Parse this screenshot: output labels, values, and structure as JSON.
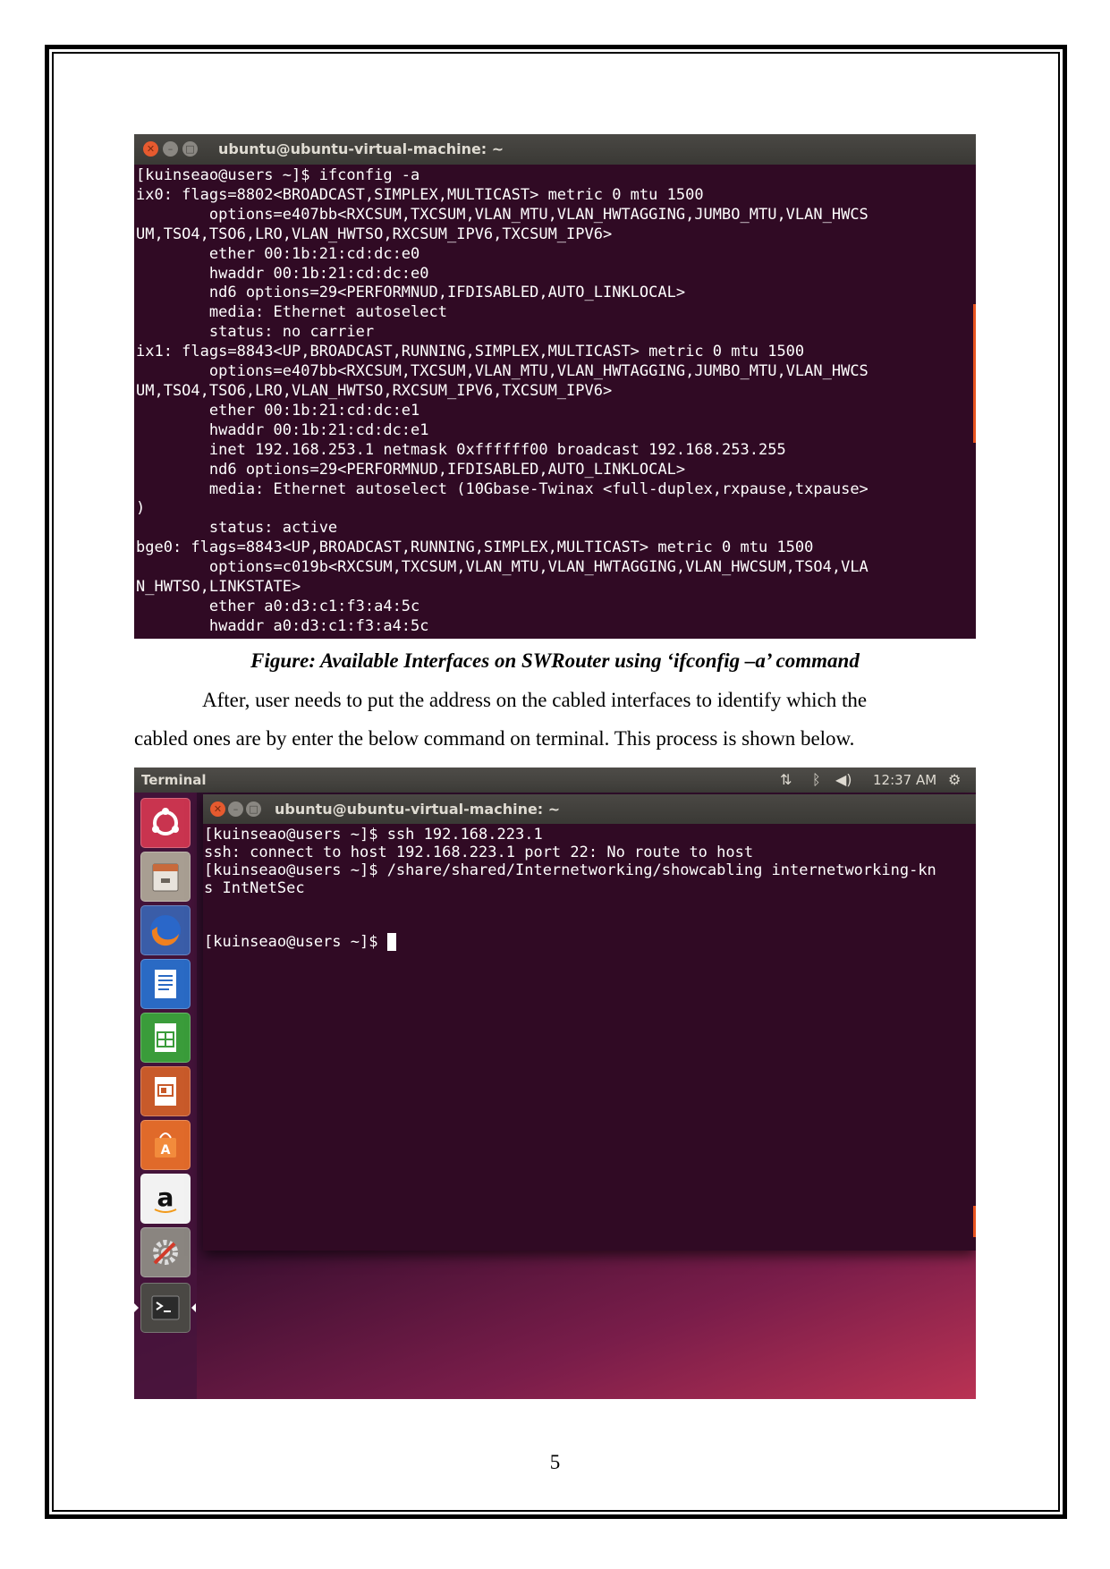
{
  "screenshot1": {
    "window_title": "ubuntu@ubuntu-virtual-machine: ~",
    "lines": [
      "[kuinseao@users ~]$ ifconfig -a",
      "ix0: flags=8802<BROADCAST,SIMPLEX,MULTICAST> metric 0 mtu 1500",
      "        options=e407bb<RXCSUM,TXCSUM,VLAN_MTU,VLAN_HWTAGGING,JUMBO_MTU,VLAN_HWCS",
      "UM,TSO4,TSO6,LRO,VLAN_HWTSO,RXCSUM_IPV6,TXCSUM_IPV6>",
      "        ether 00:1b:21:cd:dc:e0",
      "        hwaddr 00:1b:21:cd:dc:e0",
      "        nd6 options=29<PERFORMNUD,IFDISABLED,AUTO_LINKLOCAL>",
      "        media: Ethernet autoselect",
      "        status: no carrier",
      "ix1: flags=8843<UP,BROADCAST,RUNNING,SIMPLEX,MULTICAST> metric 0 mtu 1500",
      "        options=e407bb<RXCSUM,TXCSUM,VLAN_MTU,VLAN_HWTAGGING,JUMBO_MTU,VLAN_HWCS",
      "UM,TSO4,TSO6,LRO,VLAN_HWTSO,RXCSUM_IPV6,TXCSUM_IPV6>",
      "        ether 00:1b:21:cd:dc:e1",
      "        hwaddr 00:1b:21:cd:dc:e1",
      "        inet 192.168.253.1 netmask 0xffffff00 broadcast 192.168.253.255",
      "        nd6 options=29<PERFORMNUD,IFDISABLED,AUTO_LINKLOCAL>",
      "        media: Ethernet autoselect (10Gbase-Twinax <full-duplex,rxpause,txpause>",
      ")",
      "        status: active",
      "bge0: flags=8843<UP,BROADCAST,RUNNING,SIMPLEX,MULTICAST> metric 0 mtu 1500",
      "        options=c019b<RXCSUM,TXCSUM,VLAN_MTU,VLAN_HWTAGGING,VLAN_HWCSUM,TSO4,VLA",
      "N_HWTSO,LINKSTATE>",
      "        ether a0:d3:c1:f3:a4:5c",
      "        hwaddr a0:d3:c1:f3:a4:5c"
    ]
  },
  "caption": "Figure: Available Interfaces on SWRouter using ‘ifconfig –a’ command",
  "paragraph": {
    "line1": "After, user needs to put the address on the cabled interfaces to identify which the",
    "line2": "cabled ones are by enter the below command on terminal. This process is shown below."
  },
  "screenshot2": {
    "topbar_app": "Terminal",
    "clock": "12:37 AM",
    "window_title": "ubuntu@ubuntu-virtual-machine: ~",
    "lines": [
      "[kuinseao@users ~]$ ssh 192.168.223.1",
      "ssh: connect to host 192.168.223.1 port 22: No route to host",
      "[kuinseao@users ~]$ /share/shared/Internetworking/showcabling internetworking-kn",
      "s IntNetSec",
      "",
      "",
      "[kuinseao@users ~]$ "
    ],
    "launcher": [
      {
        "name": "ubuntu-dash-icon"
      },
      {
        "name": "files-icon"
      },
      {
        "name": "firefox-icon"
      },
      {
        "name": "libreoffice-writer-icon"
      },
      {
        "name": "libreoffice-calc-icon"
      },
      {
        "name": "libreoffice-impress-icon"
      },
      {
        "name": "software-center-icon"
      },
      {
        "name": "amazon-icon"
      },
      {
        "name": "system-settings-icon"
      },
      {
        "name": "terminal-icon"
      }
    ]
  },
  "page_number": "5"
}
